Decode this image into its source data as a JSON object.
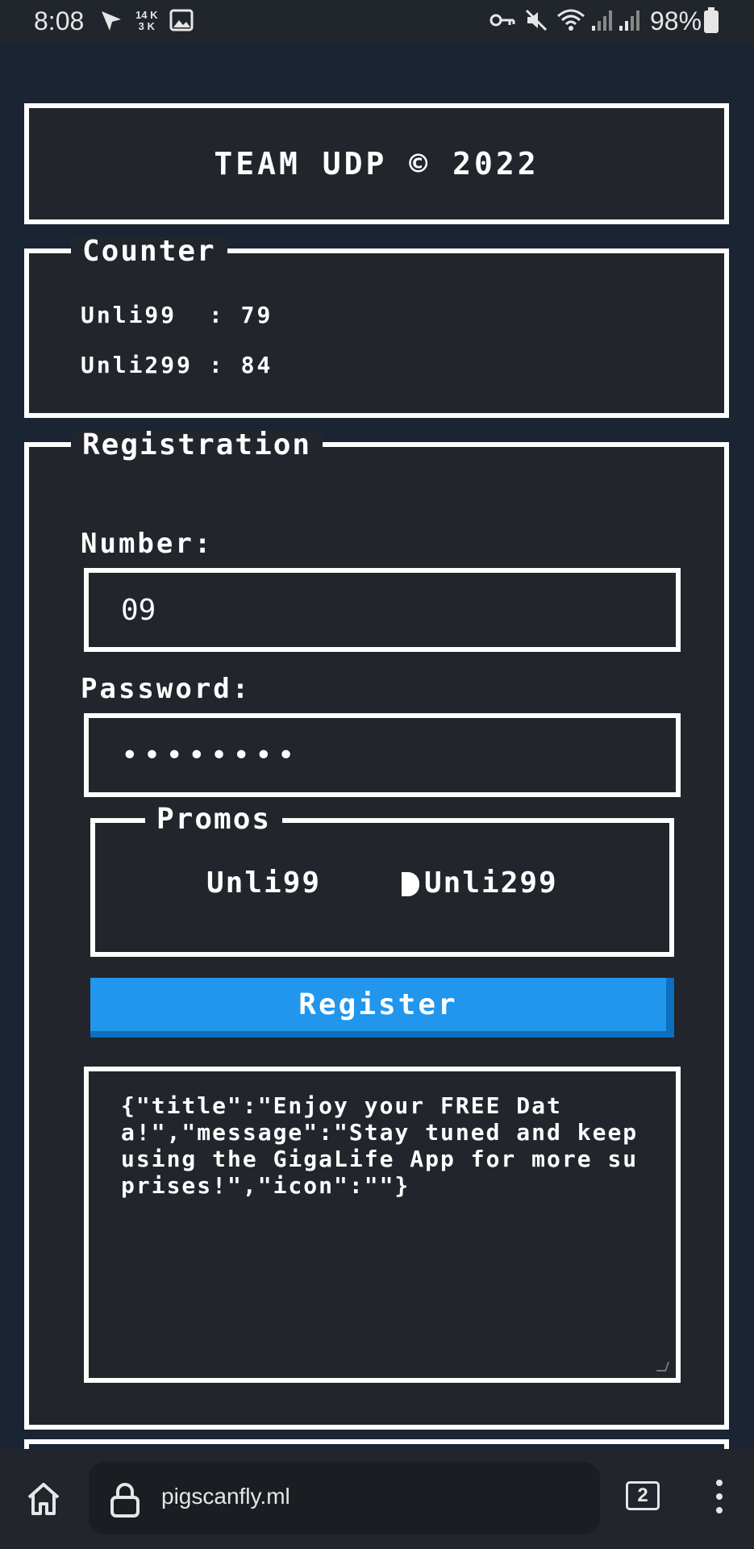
{
  "status_bar": {
    "time": "8:08",
    "net_up": "14 K",
    "net_down": "3 K",
    "battery": "98%"
  },
  "header": {
    "title": "TEAM UDP © 2022"
  },
  "counter": {
    "legend": "Counter",
    "rows": [
      {
        "label": "Unli99 ",
        "value": "79"
      },
      {
        "label": "Unli299",
        "value": "84"
      }
    ]
  },
  "registration": {
    "legend": "Registration",
    "number_label": "Number:",
    "number_value": "09",
    "password_label": "Password:",
    "password_value": "••••••••",
    "promos": {
      "legend": "Promos",
      "options": [
        "Unli99",
        "Unli299"
      ],
      "selected": "Unli299"
    },
    "register_label": "Register",
    "response": "{\"title\":\"Enjoy your FREE Data!\",\"message\":\"Stay tuned and keep using the GigaLife App for more suprises!\",\"icon\":\"\"}"
  },
  "browser": {
    "url": "pigscanfly.ml",
    "tab_count": "2"
  }
}
